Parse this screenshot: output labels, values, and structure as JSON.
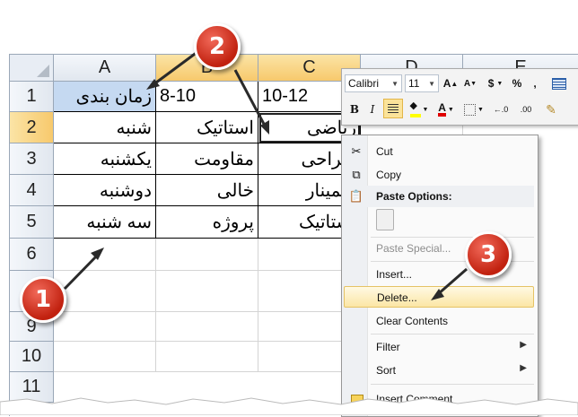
{
  "columns": [
    "A",
    "B",
    "C",
    "D",
    "E"
  ],
  "rows": [
    "1",
    "2",
    "3",
    "4",
    "5",
    "6",
    "9",
    "10",
    "11"
  ],
  "cells": {
    "A1": "زمان بندی",
    "B1": "8-10",
    "C1": "10-12",
    "A2": "شنبه",
    "B2": "استاتیک",
    "C2": "ریاضی",
    "A3": "یکشنبه",
    "B3": "مقاومت",
    "C3": "طراحی",
    "A4": "دوشنبه",
    "B4": "خالی",
    "C4": "سمینار",
    "A5": "سه شنبه",
    "B5": "پروژه",
    "C5": "استاتیک"
  },
  "mini_toolbar": {
    "font_name": "Calibri",
    "font_size": "11",
    "grow_font": "A",
    "shrink_font": "A",
    "currency": "$",
    "percent": "%",
    "comma": ",",
    "bold": "B",
    "italic": "I",
    "font_color_letter": "A",
    "inc_decimal": "←.0",
    "dec_decimal": ".00"
  },
  "context_menu": {
    "cut": "Cut",
    "copy": "Copy",
    "paste_options": "Paste Options:",
    "paste_special": "Paste Special...",
    "insert": "Insert...",
    "delete": "Delete...",
    "clear_contents": "Clear Contents",
    "filter": "Filter",
    "sort": "Sort",
    "insert_comment": "Insert Comment"
  },
  "markers": {
    "step1": "1",
    "step2": "2",
    "step3": "3"
  },
  "colors": {
    "marker_red": "#c1210f",
    "header_selected": "#f7c96c",
    "cell_a1": "#c5d9f1",
    "menu_highlight": "#fbe6a5"
  }
}
